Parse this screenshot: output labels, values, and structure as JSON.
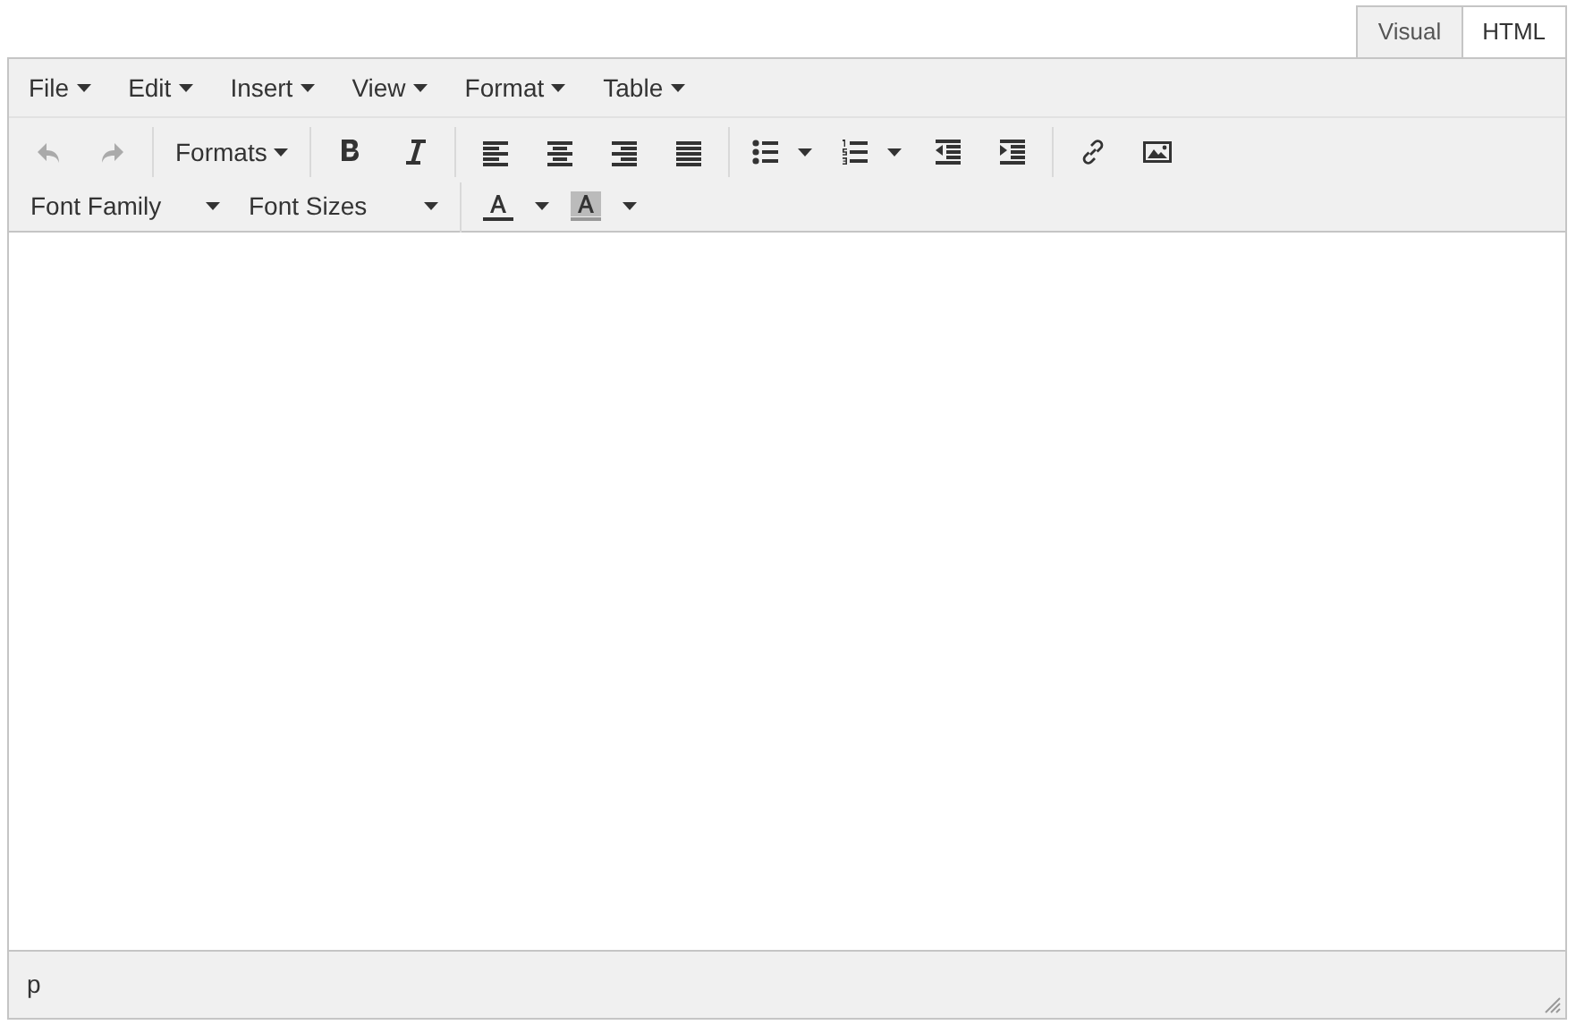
{
  "mode_tabs": [
    {
      "label": "Visual",
      "selected": true
    },
    {
      "label": "HTML",
      "selected": false
    }
  ],
  "menubar": [
    {
      "label": "File"
    },
    {
      "label": "Edit"
    },
    {
      "label": "Insert"
    },
    {
      "label": "View"
    },
    {
      "label": "Format"
    },
    {
      "label": "Table"
    }
  ],
  "toolbar_row_1": [
    {
      "kind": "undo",
      "disabled": true
    },
    {
      "kind": "redo",
      "disabled": true
    },
    {
      "kind": "separator"
    },
    {
      "kind": "dropdown",
      "label": "Formats"
    },
    {
      "kind": "separator"
    },
    {
      "kind": "bold",
      "disabled": false
    },
    {
      "kind": "italic",
      "disabled": false
    },
    {
      "kind": "separator"
    },
    {
      "kind": "alignleft",
      "disabled": false
    },
    {
      "kind": "aligncenter",
      "disabled": false
    },
    {
      "kind": "alignright",
      "disabled": false
    },
    {
      "kind": "justify",
      "disabled": false
    },
    {
      "kind": "separator"
    },
    {
      "kind": "bullist",
      "disabled": false
    },
    {
      "kind": "numlist",
      "disabled": false
    },
    {
      "kind": "outdent",
      "disabled": false
    },
    {
      "kind": "indent",
      "disabled": false
    },
    {
      "kind": "separator"
    },
    {
      "kind": "link",
      "disabled": false
    },
    {
      "kind": "image",
      "disabled": false
    }
  ],
  "toolbar_row_2": [
    {
      "kind": "select",
      "label": "Font Family"
    },
    {
      "kind": "select",
      "label": "Font Sizes"
    },
    {
      "kind": "separator"
    },
    {
      "kind": "forecolor",
      "disabled": false
    },
    {
      "kind": "backcolor",
      "disabled": false
    }
  ],
  "status_bar": {
    "path": "p"
  }
}
